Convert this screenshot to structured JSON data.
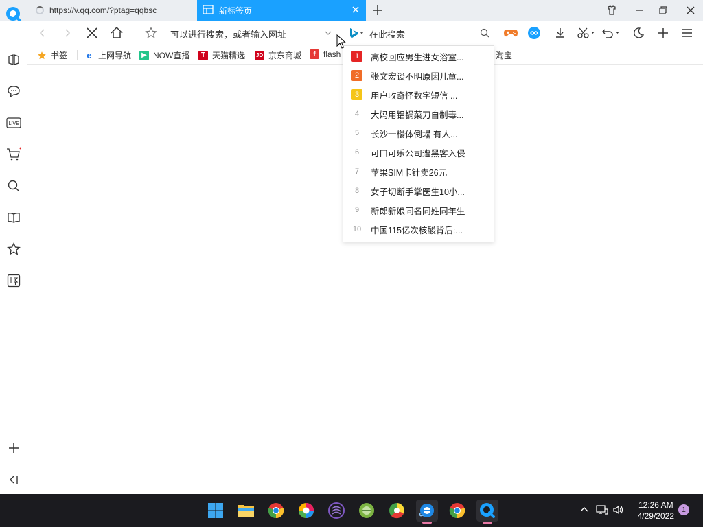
{
  "tabs": [
    {
      "label": "https://v.qq.com/?ptag=qqbsc",
      "loading": true
    },
    {
      "label": "新标签页",
      "active": true
    }
  ],
  "toolbar": {
    "address_placeholder": "可以进行搜索，或者输入网址",
    "search_placeholder": "在此搜索",
    "search_engine_icon": "bing-icon"
  },
  "bookmarks": [
    {
      "label": "书签",
      "icon": "star-icon",
      "color": "#f5a623"
    },
    {
      "label": "上网导航",
      "icon": "ie-icon",
      "color": "#1a73e8"
    },
    {
      "label": "NOW直播",
      "icon": "now-icon",
      "color": "#22c58b"
    },
    {
      "label": "天猫精选",
      "icon": "tmall-icon",
      "color": "#d0021b"
    },
    {
      "label": "京东商城",
      "icon": "jd-icon",
      "color": "#d0021b"
    },
    {
      "label": "flash",
      "icon": "flash-icon",
      "color": "#e53935"
    },
    {
      "label": "淘宝",
      "icon": "taobao-icon",
      "color": "#ff5000"
    }
  ],
  "hot_search": [
    {
      "rank": "1",
      "text": "高校回应男生进女浴室...",
      "color": "#e52525"
    },
    {
      "rank": "2",
      "text": "张文宏谈不明原因儿童...",
      "color": "#f06d28"
    },
    {
      "rank": "3",
      "text": "用户收奇怪数字短信 ...",
      "color": "#f5c518"
    },
    {
      "rank": "4",
      "text": "大妈用铝锅菜刀自制毒..."
    },
    {
      "rank": "5",
      "text": "长沙一楼体倒塌 有人..."
    },
    {
      "rank": "6",
      "text": "可口可乐公司遭黑客入侵"
    },
    {
      "rank": "7",
      "text": "苹果SIM卡针卖26元"
    },
    {
      "rank": "8",
      "text": "女子切断手掌医生10小..."
    },
    {
      "rank": "9",
      "text": "新郎新娘同名同姓同年生"
    },
    {
      "rank": "10",
      "text": "中国115亿次核酸背后:..."
    }
  ],
  "clock": {
    "time": "12:26 AM",
    "date": "4/29/2022"
  },
  "notifications": "1",
  "sidebar_icons": [
    "apps-icon",
    "chat-icon",
    "live-icon",
    "cart-icon",
    "search-icon",
    "book-icon",
    "favorite-icon",
    "translate-icon",
    "add-icon",
    "collapse-icon"
  ],
  "colors": {
    "accent": "#1aa1ff",
    "taskbar": "#1b1b1f"
  }
}
